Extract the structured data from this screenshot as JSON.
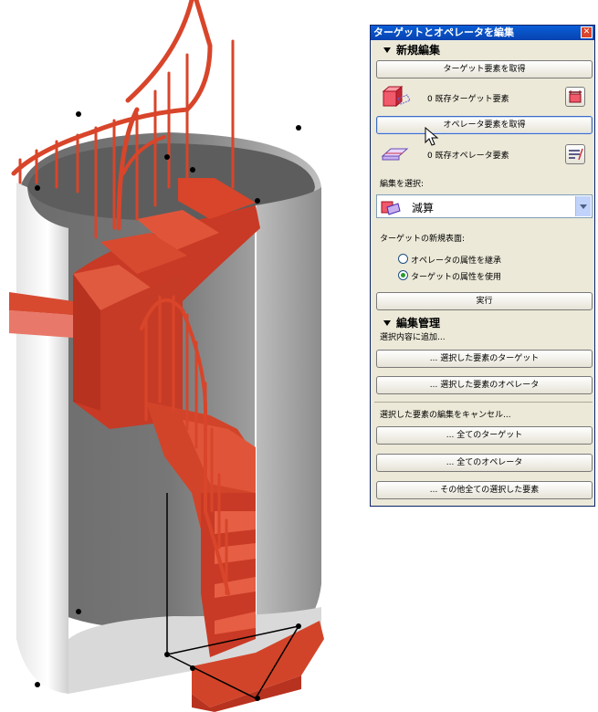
{
  "palette": {
    "title": "ターゲットとオペレータを編集",
    "new_edit": {
      "heading": "新規編集",
      "get_target_button": "ターゲット要素を取得",
      "existing_targets": "0 既存ターゲット要素",
      "get_operator_button": "オペレータ要素を取得",
      "existing_operators": "0 既存オペレータ要素",
      "select_edit_label": "編集を選択:",
      "edit_mode_selected": "減算",
      "new_surface_label": "ターゲットの新規表面:",
      "radio_inherit_operator": "オペレータの属性を継承",
      "radio_use_target": "ターゲットの属性を使用",
      "selected_radio": "use_target",
      "execute_button": "実行"
    },
    "edit_management": {
      "heading": "編集管理",
      "add_to_selection_label": "選択内容に追加...",
      "selected_targets_button": "... 選択した要素のターゲット",
      "selected_operators_button": "... 選択した要素のオペレータ",
      "cancel_label": "選択した要素の編集をキャンセル...",
      "all_targets_button": "... 全てのターゲット",
      "all_operators_button": "... 全てのオペレータ",
      "all_other_button": "... その他全ての選択した要素"
    }
  },
  "colors": {
    "stair_red": "#d8452a",
    "wall_grey": "#8e8e8e",
    "title_blue": "#0a5fd8"
  }
}
